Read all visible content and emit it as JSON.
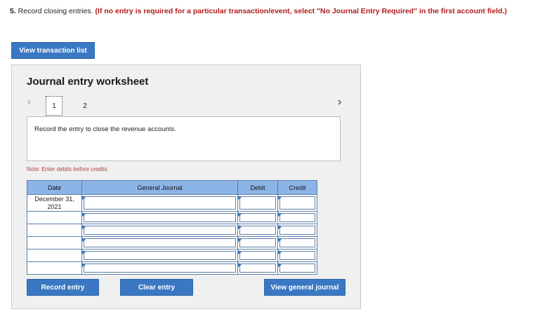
{
  "instructions": {
    "number": "5.",
    "text": " Record closing entries. ",
    "required": "(If no entry is required for a particular transaction/event, select \"No Journal Entry Required\" in the first account field.)"
  },
  "buttons": {
    "view_transactions": "View transaction list",
    "record_entry": "Record entry",
    "clear_entry": "Clear entry",
    "view_general_journal": "View general journal"
  },
  "worksheet": {
    "title": "Journal entry worksheet",
    "pages": [
      "1",
      "2"
    ],
    "active_page": "1",
    "prev_icon": "chevron-left-icon",
    "next_icon": "chevron-right-icon",
    "description": "Record the entry to close the revenue accounts.",
    "note": "Note: Enter debits before credits."
  },
  "table": {
    "headers": [
      "Date",
      "General Journal",
      "Debit",
      "Credit"
    ],
    "rows": [
      {
        "date": "December 31, 2021"
      },
      {
        "date": ""
      },
      {
        "date": ""
      },
      {
        "date": ""
      },
      {
        "date": ""
      },
      {
        "date": ""
      }
    ]
  },
  "colors": {
    "button": "#3a78c3",
    "header": "#8cb4e6",
    "required_text": "#b01c1c"
  }
}
